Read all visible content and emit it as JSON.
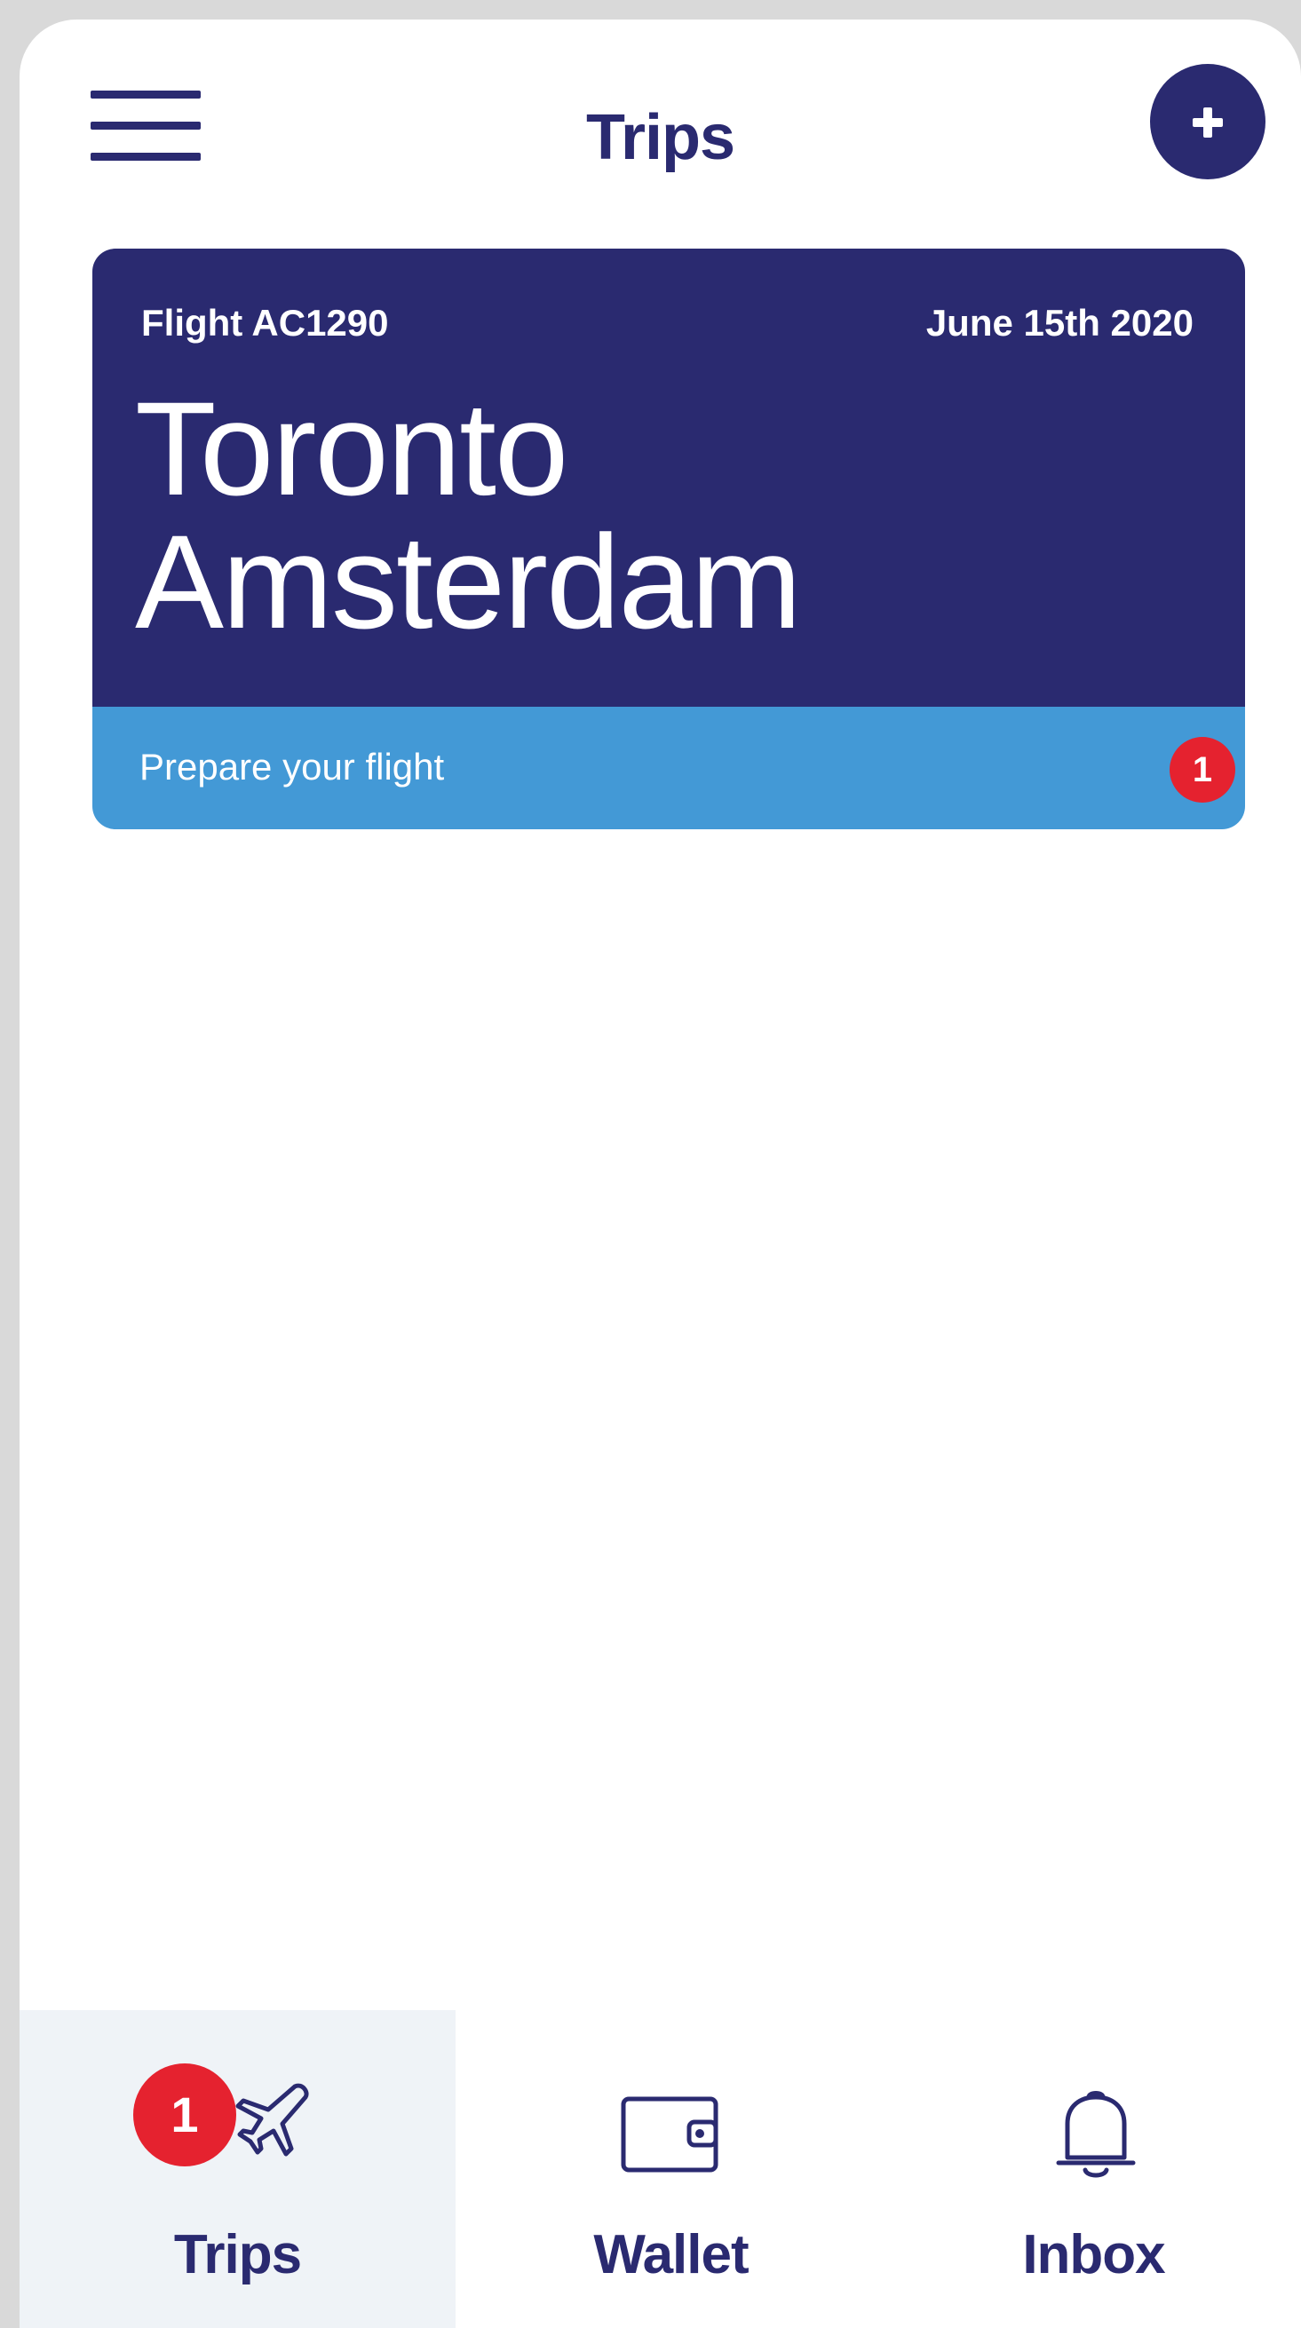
{
  "header": {
    "title": "Trips",
    "menu_icon": "hamburger-menu-icon",
    "add_icon": "plus-icon"
  },
  "trip": {
    "flight": "Flight AC1290",
    "date": "June 15th 2020",
    "origin": "Toronto",
    "destination": "Amsterdam",
    "prepare_label": "Prepare your flight",
    "prepare_badge": "1"
  },
  "nav": {
    "items": [
      {
        "label": "Trips",
        "icon": "airplane-icon",
        "badge": "1",
        "active": true
      },
      {
        "label": "Wallet",
        "icon": "wallet-icon",
        "active": false
      },
      {
        "label": "Inbox",
        "icon": "bell-icon",
        "active": false
      }
    ]
  },
  "colors": {
    "navy": "#2a2a70",
    "sky_blue": "#4399d6",
    "badge_red": "#e5222f",
    "active_tab_bg": "#eff3f7"
  }
}
